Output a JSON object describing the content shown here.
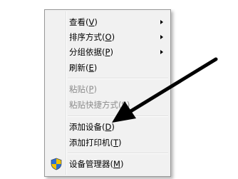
{
  "context_menu": {
    "items": [
      {
        "label": "查看",
        "key": "V"
      },
      {
        "label": "排序方式",
        "key": "O"
      },
      {
        "label": "分组依据",
        "key": "P"
      },
      {
        "label": "刷新",
        "key": "E"
      },
      {
        "label": "粘贴",
        "key": "P"
      },
      {
        "label": "粘贴快捷方式",
        "key": "S"
      },
      {
        "label": "添加设备",
        "key": "D"
      },
      {
        "label": "添加打印机",
        "key": "T"
      },
      {
        "label": "设备管理器",
        "key": "M"
      }
    ]
  },
  "icons": {
    "device_manager": "uac-shield-icon"
  },
  "colors": {
    "menu_background": "#f1f1f1",
    "disabled_text": "#8d8d8d",
    "annotation_arrow": "#000000",
    "shield_blue": "#2a6fd6",
    "shield_yellow": "#f2c200"
  }
}
